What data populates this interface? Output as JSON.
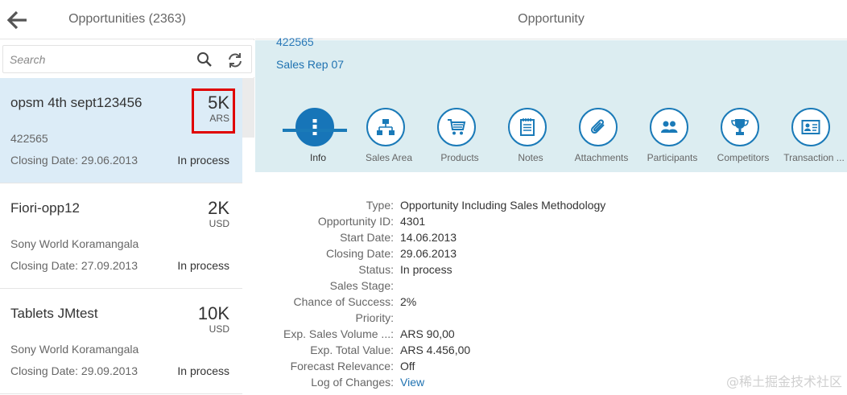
{
  "master": {
    "title": "Opportunities (2363)",
    "search_placeholder": "Search",
    "items": [
      {
        "title": "opsm 4th sept123456",
        "amount": "5K",
        "currency": "ARS",
        "subtitle": "422565",
        "closing": "Closing Date: 29.06.2013",
        "status": "In process",
        "selected": true
      },
      {
        "title": "Fiori-opp12",
        "amount": "2K",
        "currency": "USD",
        "subtitle": "Sony World Koramangala",
        "closing": "Closing Date: 27.09.2013",
        "status": "In process",
        "selected": false
      },
      {
        "title": "Tablets JMtest",
        "amount": "10K",
        "currency": "USD",
        "subtitle": "Sony World Koramangala",
        "closing": "Closing Date: 29.09.2013",
        "status": "In process",
        "selected": false
      }
    ]
  },
  "detail": {
    "title": "Opportunity",
    "header": {
      "id": "422565",
      "rep": "Sales Rep 07"
    },
    "tabs": [
      {
        "label": "Info",
        "icon": "info-icon"
      },
      {
        "label": "Sales Area",
        "icon": "hierarchy-icon"
      },
      {
        "label": "Products",
        "icon": "cart-icon"
      },
      {
        "label": "Notes",
        "icon": "notes-icon"
      },
      {
        "label": "Attachments",
        "icon": "paperclip-icon"
      },
      {
        "label": "Participants",
        "icon": "group-icon"
      },
      {
        "label": "Competitors",
        "icon": "trophy-icon"
      },
      {
        "label": "Transaction ...",
        "icon": "id-card-icon"
      }
    ],
    "fields": [
      {
        "label": "Type:",
        "value": "Opportunity Including Sales Methodology"
      },
      {
        "label": "Opportunity ID:",
        "value": "4301"
      },
      {
        "label": "Start Date:",
        "value": "14.06.2013"
      },
      {
        "label": "Closing Date:",
        "value": "29.06.2013"
      },
      {
        "label": "Status:",
        "value": "In process"
      },
      {
        "label": "Sales Stage:",
        "value": ""
      },
      {
        "label": "Chance of Success:",
        "value": "2%"
      },
      {
        "label": "Priority:",
        "value": ""
      },
      {
        "label": "Exp. Sales Volume ...:",
        "value": "ARS 90,00"
      },
      {
        "label": "Exp. Total Value:",
        "value": "ARS 4.456,00"
      },
      {
        "label": "Forecast Relevance:",
        "value": "Off"
      },
      {
        "label": "Log of Changes:",
        "value": "View"
      }
    ]
  },
  "watermark": "@稀土掘金技术社区",
  "colors": {
    "accent": "#1a7ab8",
    "selected_row": "#dcecf7",
    "header_band": "#dcedf1",
    "highlight": "#e00000"
  }
}
